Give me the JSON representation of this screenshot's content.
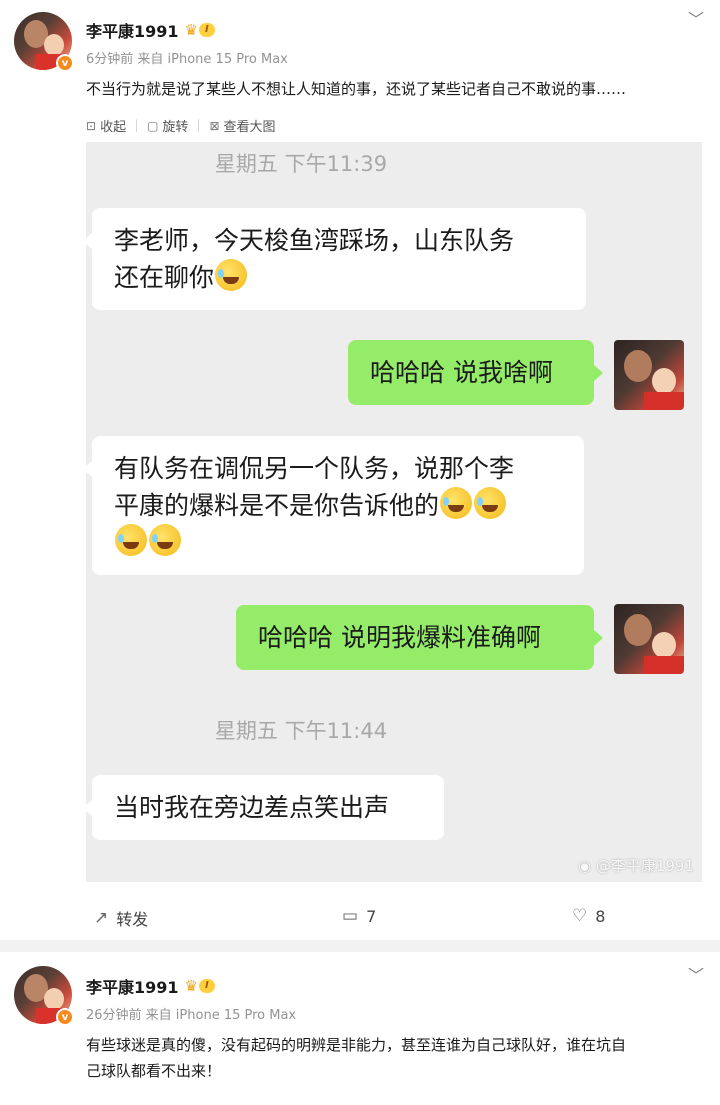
{
  "post1": {
    "username": "李平康1991",
    "level": "I",
    "meta": "6分钟前 来自 iPhone 15 Pro Max",
    "text": "不当行为就是说了某些人不想让人知道的事，还说了某些记者自己不敢说的事……",
    "sub_actions": {
      "collapse": "收起",
      "rotate": "旋转",
      "view_large": "查看大图"
    },
    "chat": {
      "timestamp1": "星期五 下午11:39",
      "msg1_line1": "李老师，今天梭鱼湾踩场，山东队务",
      "msg1_line2": "还在聊你",
      "msg2": "哈哈哈 说我啥啊",
      "msg3_line1": "有队务在调侃另一个队务，说那个李",
      "msg3_line2": "平康的爆料是不是你告诉他的",
      "msg4": "哈哈哈 说明我爆料准确啊",
      "timestamp2": "星期五 下午11:44",
      "msg5": "当时我在旁边差点笑出声",
      "watermark": "@李平康1991"
    },
    "actions": {
      "repost": "转发",
      "comments": "7",
      "likes": "8"
    }
  },
  "post2": {
    "username": "李平康1991",
    "level": "I",
    "meta": "26分钟前 来自 iPhone 15 Pro Max",
    "text_line1": "有些球迷是真的傻，没有起码的明辨是非能力，甚至连谁为自己球队好，谁在坑自",
    "text_line2": "己球队都看不出来！"
  },
  "colors": {
    "accent_orange": "#f58a1f",
    "chat_green": "#95ec69",
    "chat_bg": "#ededed"
  }
}
